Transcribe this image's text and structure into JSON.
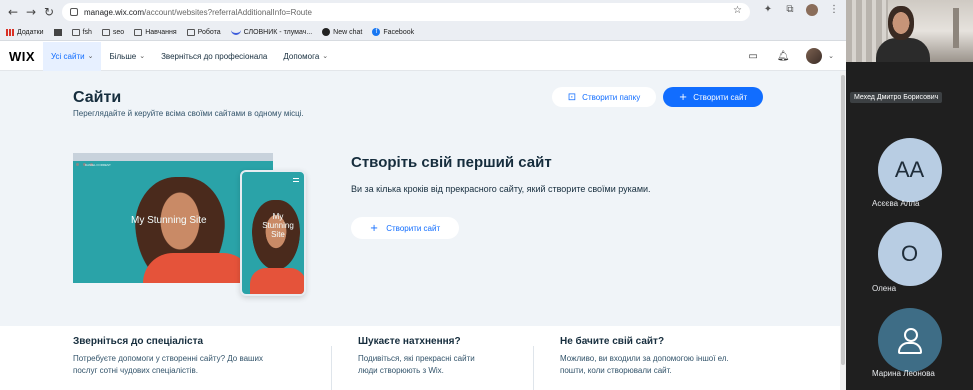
{
  "browser": {
    "url_host": "manage.wix.com",
    "url_path": "/account/websites?referralAdditionalInfo=Route",
    "bookmarks": [
      "Додатки",
      "fsh",
      "seo",
      "Навчання",
      "Робота",
      "СЛОВНИК - тлумач...",
      "New chat",
      "Facebook"
    ]
  },
  "header": {
    "logo": "WIX",
    "menu": [
      "Усі сайти",
      "Більше",
      "Зверніться до професіонала",
      "Допомога"
    ]
  },
  "main": {
    "title": "Сайти",
    "subtitle": "Переглядайте й керуйте всіма своїми сайтами в одному місці.",
    "create_folder": "Створити папку",
    "create_site": "Створити сайт",
    "hero_text": "My Stunning Site",
    "hero_label": "DANIEL FORREST",
    "promo_title": "Створіть свій перший сайт",
    "promo_text": "Ви за кілька кроків від прекрасного сайту, який створите своїми руками.",
    "promo_button": "Створити сайт"
  },
  "cards": [
    {
      "title": "Зверніться до спеціаліста",
      "line1": "Потребуєте допомоги у створенні сайту? До ваших",
      "line2": "послуг сотні чудових спеціалістів."
    },
    {
      "title": "Шукаєте натхнення?",
      "line1": "Подивіться, які прекрасні сайти",
      "line2": "люди створюють з Wix."
    },
    {
      "title": "Не бачите свій сайт?",
      "line1": "Можливо, ви входили за допомогою іншої ел.",
      "line2": "пошти, коли створювали сайт."
    }
  ],
  "video": {
    "speaker": "Мехед Дмитро Борисович",
    "participants": [
      {
        "initials": "AA",
        "name": "Асєєва Алла",
        "color": "#b8cde3"
      },
      {
        "initials": "O",
        "name": "Олена",
        "color": "#b8cde3"
      },
      {
        "initials": "",
        "name": "Марина Леонова",
        "color": "#3e6d86"
      }
    ]
  }
}
